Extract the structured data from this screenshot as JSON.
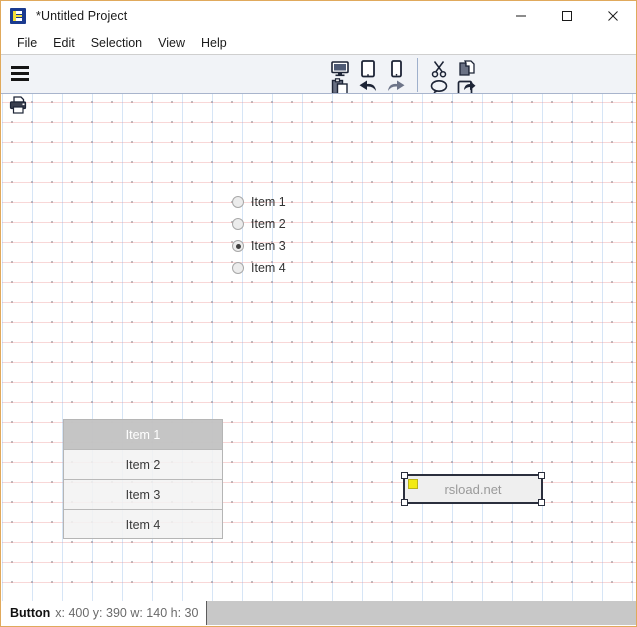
{
  "window": {
    "title": "*Untitled Project",
    "app_icon": "app-logo-icon",
    "controls": {
      "minimize": "minimize-icon",
      "maximize": "maximize-icon",
      "close": "close-icon"
    }
  },
  "menubar": {
    "items": [
      {
        "label": "File"
      },
      {
        "label": "Edit"
      },
      {
        "label": "Selection"
      },
      {
        "label": "View"
      },
      {
        "label": "Help"
      }
    ]
  },
  "toolbar": {
    "menu_icon": "hamburger-menu-icon",
    "groups": [
      {
        "name": "device-preview",
        "buttons": [
          {
            "icon": "desktop-icon",
            "row": "top"
          },
          {
            "icon": "tablet-icon",
            "row": "top"
          },
          {
            "icon": "phone-icon",
            "row": "top"
          },
          {
            "icon": "paste-icon",
            "row": "bottom"
          },
          {
            "icon": "undo-icon",
            "row": "bottom"
          },
          {
            "icon": "redo-icon",
            "row": "bottom"
          }
        ]
      },
      {
        "name": "clipboard",
        "buttons": [
          {
            "icon": "cut-scissors-icon",
            "row": "top"
          },
          {
            "icon": "copy-icon",
            "row": "top"
          },
          {
            "icon": "comment-bubble-icon",
            "row": "bottom"
          },
          {
            "icon": "share-export-icon",
            "row": "bottom"
          }
        ]
      }
    ]
  },
  "canvas": {
    "print_icon": "printer-icon",
    "radio_group": {
      "name": "radio-button-group",
      "items": [
        {
          "label": "Item 1",
          "checked": false
        },
        {
          "label": "Item 2",
          "checked": false
        },
        {
          "label": "Item 3",
          "checked": true
        },
        {
          "label": "Item 4",
          "checked": false
        }
      ]
    },
    "list_widget": {
      "name": "list-widget",
      "items": [
        {
          "label": "Item 1",
          "selected": true
        },
        {
          "label": "Item 2",
          "selected": false
        },
        {
          "label": "Item 3",
          "selected": false
        },
        {
          "label": "Item 4",
          "selected": false
        }
      ]
    },
    "selected_button": {
      "label": "rsload.net",
      "anchor_color": "#f3ea12",
      "border_color": "#2b2f3d"
    }
  },
  "statusbar": {
    "element_type": "Button",
    "geometry": "x: 400 y: 390 w: 140 h: 30"
  }
}
